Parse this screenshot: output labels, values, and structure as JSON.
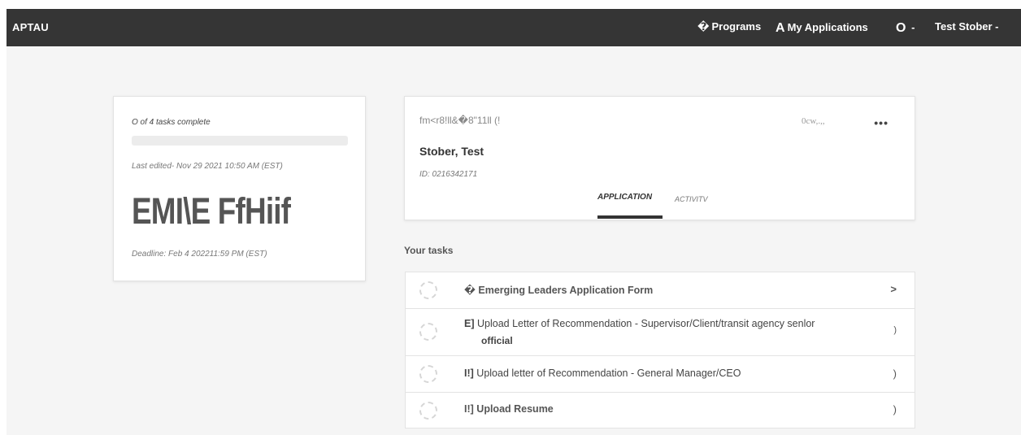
{
  "header": {
    "brand": "APTAU",
    "programs_glyph": "�",
    "programs_label": "Programs",
    "applications_glyph": "A",
    "applications_label": "My Applications",
    "notifications_glyph": "O",
    "notifications_suffix": "-",
    "user_label": "Test Stober -"
  },
  "progress_card": {
    "tasks_complete": "O of 4 tasks complete",
    "progress_fraction": 0,
    "last_edited": "Last edited- Nov 29 2021 10:50 AM (EST)",
    "status_text": "EMI\\E FfHiif",
    "deadline": "Deadline: Feb 4 202211:59 PM (EST)"
  },
  "application_card": {
    "program_title": "fm<r8!ll&�8\"11ll (!",
    "status_label": "0cw,.,,",
    "menu_icon": "more-icon",
    "applicant_name": "Stober, Test",
    "applicant_id": "ID: 0216342171",
    "tabs": [
      {
        "label": "APPLICATION",
        "active": true
      },
      {
        "label": "ACTIVITV",
        "active": false
      }
    ]
  },
  "tasks_section": {
    "heading": "Your tasks",
    "tasks": [
      {
        "prefix": "�",
        "label": "Emerging Leaders Application Form",
        "chevron": ">"
      },
      {
        "prefix": "E]",
        "label": "Upload Letter of Recommendation - Supervisor/Client/transit agency senlor",
        "label_line2": "official",
        "chevron": ")"
      },
      {
        "prefix": "I!]",
        "label": "Upload letter of Recommendation - General Manager/CEO",
        "chevron": ")"
      },
      {
        "prefix": "I!]",
        "label": "Upload Resume",
        "chevron": ")"
      }
    ]
  },
  "colors": {
    "header_bg": "#353535",
    "content_bg": "#f5f5f5",
    "card_bg": "#ffffff"
  }
}
